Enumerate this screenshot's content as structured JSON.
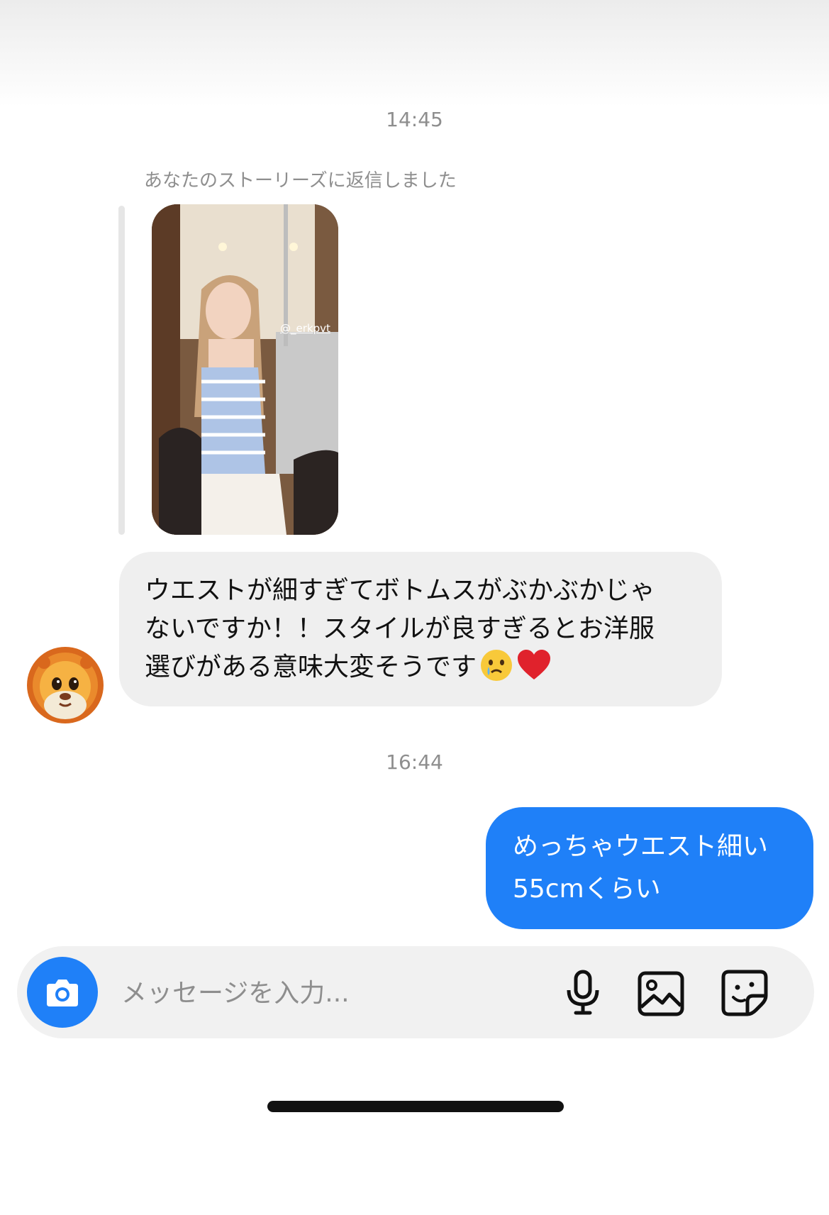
{
  "conversation": {
    "timestamps": [
      "14:45",
      "16:44"
    ],
    "story_reply": {
      "caption": "あなたのストーリーズに返信しました",
      "story_username_tag": "@_erkpvt"
    },
    "incoming_message": {
      "lines": [
        "ウエストが細すぎてボトムスがぶかぶかじゃ",
        "ないですか！！スタイルが良すぎるとお洋服",
        "選びがある意味大変そうです"
      ],
      "emojis": [
        "crying-face",
        "red-heart"
      ],
      "sender_avatar": "lion-memoji"
    },
    "outgoing_message": {
      "lines": [
        "めっちゃウエスト細い",
        "55cmくらい"
      ]
    }
  },
  "composer": {
    "placeholder": "メッセージを入力...",
    "value": "",
    "icons": [
      "camera-icon",
      "microphone-icon",
      "image-icon",
      "sticker-icon"
    ]
  },
  "colors": {
    "accent_blue": "#1f80f8",
    "incoming_bubble": "#efefef",
    "muted_text": "#8e8e8e"
  }
}
